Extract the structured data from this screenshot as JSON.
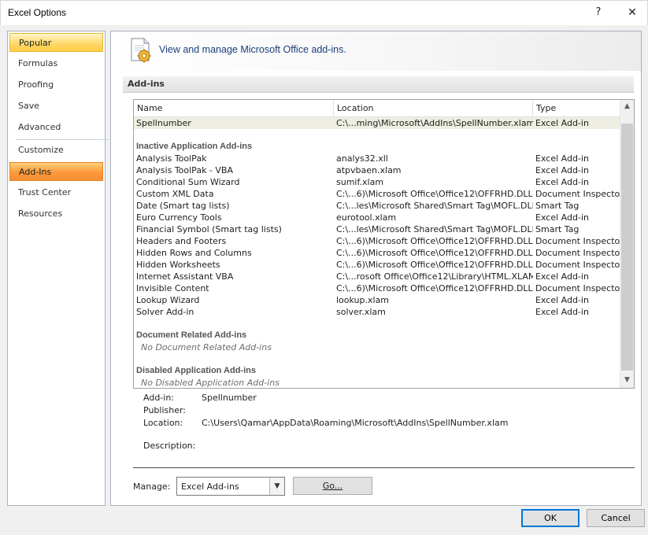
{
  "window": {
    "title": "Excel Options",
    "help_glyph": "?",
    "close_glyph": "✕"
  },
  "sidebar": {
    "items": [
      {
        "label": "Popular"
      },
      {
        "label": "Formulas"
      },
      {
        "label": "Proofing"
      },
      {
        "label": "Save"
      },
      {
        "label": "Advanced"
      },
      {
        "label": "Customize"
      },
      {
        "label": "Add-Ins"
      },
      {
        "label": "Trust Center"
      },
      {
        "label": "Resources"
      }
    ],
    "selected": "Add-Ins",
    "colors": {
      "selected": "#f8963a",
      "home": "#ffd765"
    }
  },
  "banner": {
    "text": "View and manage Microsoft Office add-ins.",
    "icon": "add-ins-gear-icon"
  },
  "section": {
    "title": "Add-ins"
  },
  "list": {
    "columns": {
      "name": "Name",
      "location": "Location",
      "type": "Type"
    },
    "active": [
      {
        "name": "Spellnumber",
        "location": "C:\\...ming\\Microsoft\\AddIns\\SpellNumber.xlam",
        "type": "Excel Add-in"
      }
    ],
    "inactive_title": "Inactive Application Add-ins",
    "inactive": [
      {
        "name": "Analysis ToolPak",
        "location": "analys32.xll",
        "type": "Excel Add-in"
      },
      {
        "name": "Analysis ToolPak - VBA",
        "location": "atpvbaen.xlam",
        "type": "Excel Add-in"
      },
      {
        "name": "Conditional Sum Wizard",
        "location": "sumif.xlam",
        "type": "Excel Add-in"
      },
      {
        "name": "Custom XML Data",
        "location": "C:\\...6)\\Microsoft Office\\Office12\\OFFRHD.DLL",
        "type": "Document Inspector"
      },
      {
        "name": "Date (Smart tag lists)",
        "location": "C:\\...les\\Microsoft Shared\\Smart Tag\\MOFL.DLL",
        "type": "Smart Tag"
      },
      {
        "name": "Euro Currency Tools",
        "location": "eurotool.xlam",
        "type": "Excel Add-in"
      },
      {
        "name": "Financial Symbol (Smart tag lists)",
        "location": "C:\\...les\\Microsoft Shared\\Smart Tag\\MOFL.DLL",
        "type": "Smart Tag"
      },
      {
        "name": "Headers and Footers",
        "location": "C:\\...6)\\Microsoft Office\\Office12\\OFFRHD.DLL",
        "type": "Document Inspector"
      },
      {
        "name": "Hidden Rows and Columns",
        "location": "C:\\...6)\\Microsoft Office\\Office12\\OFFRHD.DLL",
        "type": "Document Inspector"
      },
      {
        "name": "Hidden Worksheets",
        "location": "C:\\...6)\\Microsoft Office\\Office12\\OFFRHD.DLL",
        "type": "Document Inspector"
      },
      {
        "name": "Internet Assistant VBA",
        "location": "C:\\...rosoft Office\\Office12\\Library\\HTML.XLAM",
        "type": "Excel Add-in"
      },
      {
        "name": "Invisible Content",
        "location": "C:\\...6)\\Microsoft Office\\Office12\\OFFRHD.DLL",
        "type": "Document Inspector"
      },
      {
        "name": "Lookup Wizard",
        "location": "lookup.xlam",
        "type": "Excel Add-in"
      },
      {
        "name": "Solver Add-in",
        "location": "solver.xlam",
        "type": "Excel Add-in"
      }
    ],
    "document_title": "Document Related Add-ins",
    "document_empty": "No Document Related Add-ins",
    "disabled_title": "Disabled Application Add-ins",
    "disabled_empty": "No Disabled Application Add-ins"
  },
  "details": {
    "addin_label": "Add-in:",
    "addin_value": "Spellnumber",
    "publisher_label": "Publisher:",
    "publisher_value": "",
    "location_label": "Location:",
    "location_value": "C:\\Users\\Qamar\\AppData\\Roaming\\Microsoft\\AddIns\\SpellNumber.xlam",
    "description_label": "Description:",
    "description_value": ""
  },
  "manage": {
    "label": "Manage:",
    "selected": "Excel Add-ins",
    "go_label": "Go..."
  },
  "buttons": {
    "ok": "OK",
    "cancel": "Cancel"
  }
}
